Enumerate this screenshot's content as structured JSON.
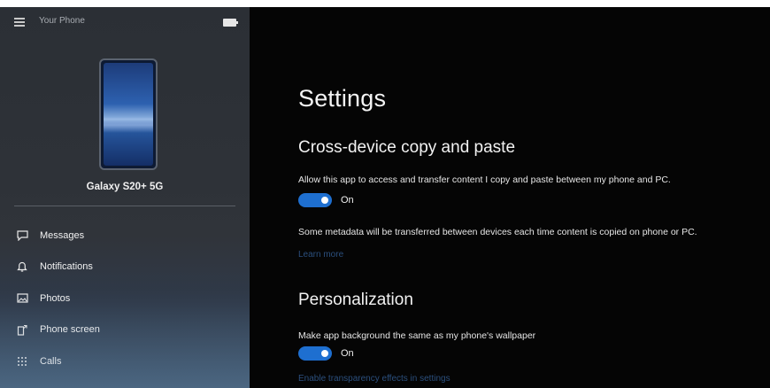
{
  "sidebar": {
    "app_title": "Your Phone",
    "device_name": "Galaxy S20+ 5G",
    "nav": [
      {
        "label": "Messages",
        "icon": "chat-bubble-icon"
      },
      {
        "label": "Notifications",
        "icon": "bell-icon"
      },
      {
        "label": "Photos",
        "icon": "photo-icon"
      },
      {
        "label": "Phone screen",
        "icon": "phone-screen-icon"
      },
      {
        "label": "Calls",
        "icon": "dialpad-icon"
      }
    ]
  },
  "settings": {
    "title": "Settings",
    "copy_paste": {
      "heading": "Cross-device copy and paste",
      "description": "Allow this app to access and transfer content I copy and paste between my phone and PC.",
      "toggle_state": "On",
      "note": "Some metadata will be transferred between devices each time content is copied on phone or PC.",
      "learn_more": "Learn more"
    },
    "personalization": {
      "heading": "Personalization",
      "description": "Make app background the same as my phone's wallpaper",
      "toggle_state": "On",
      "link": "Enable transparency effects in settings"
    }
  },
  "colors": {
    "accent": "#1e6fd0",
    "link": "#2b4f7d",
    "main_bg": "#050505",
    "sidebar_bg": "#2e3238"
  }
}
